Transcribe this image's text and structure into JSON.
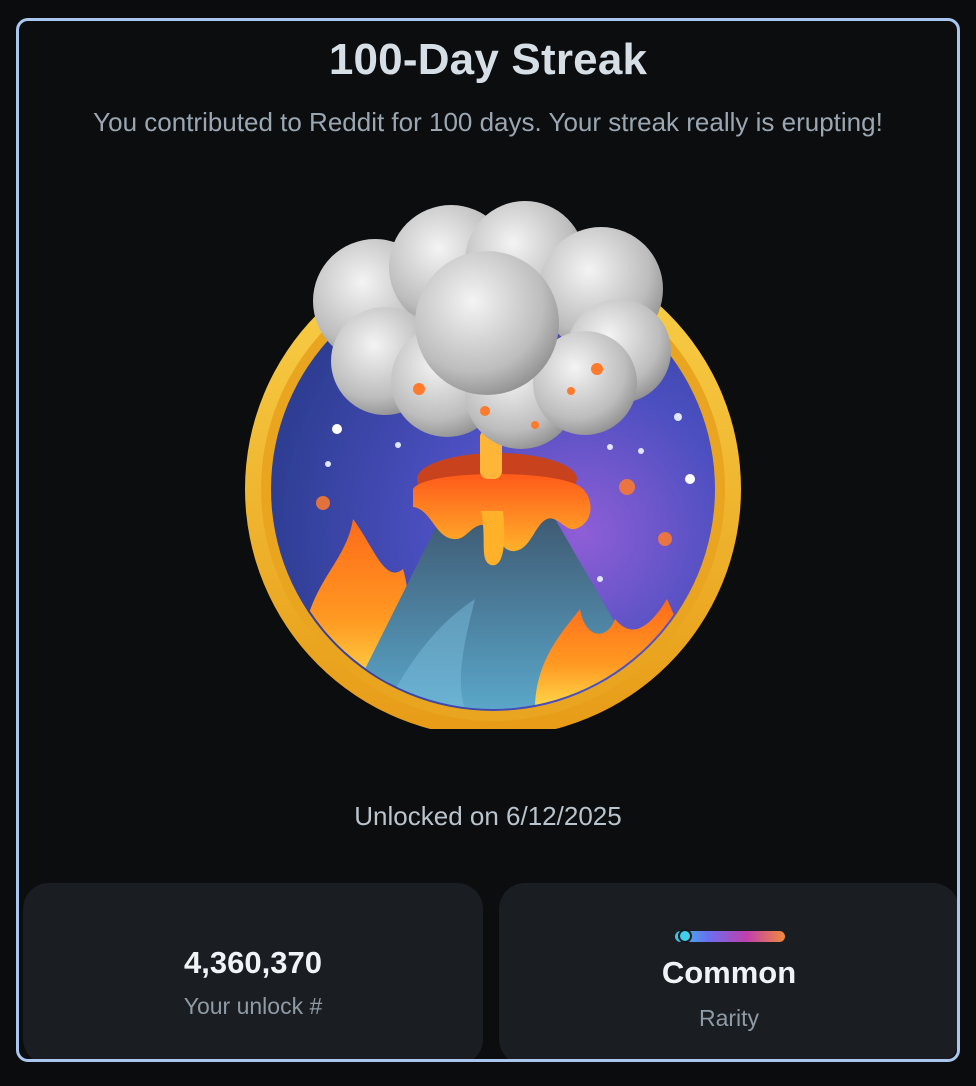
{
  "achievement": {
    "title": "100-Day Streak",
    "description": "You contributed to Reddit for 100 days. Your streak really is erupting!",
    "unlocked_text": "Unlocked on 6/12/2025",
    "badge_icon": "volcano-badge-icon"
  },
  "stats": {
    "unlock_number": "4,360,370",
    "unlock_label": "Your unlock #",
    "rarity_value": "Common",
    "rarity_label": "Rarity",
    "rarity_level": 0.05
  },
  "colors": {
    "border": "#a9c6ee",
    "background": "#0c0d0f",
    "card": "#1a1d21",
    "badge_ring": "#f2b52a",
    "lava": "#f26a1f"
  }
}
